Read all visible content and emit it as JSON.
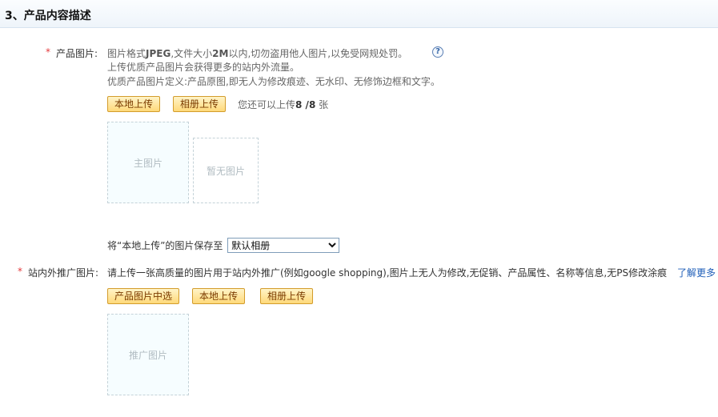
{
  "section": {
    "title": "3、产品内容描述"
  },
  "product_images": {
    "required_mark": "*",
    "label": "产品图片:",
    "hints": [
      [
        "图片格式",
        "JPEG",
        ",文件大小",
        "2M",
        "以内,切勿盗用他人图片,以免受网规处罚。"
      ],
      "上传优质产品图片会获得更多的站内外流量。",
      "优质产品图片定义:产品原图,即无人为修改痕迹、无水印、无修饰边框和文字。"
    ],
    "help_icon": "?",
    "buttons": {
      "local_upload": "本地上传",
      "album_upload": "相册上传"
    },
    "remaining": {
      "prefix": "您还可以上传",
      "count": "8",
      "separator": " /",
      "total": "8",
      "suffix": " 张"
    },
    "slots": {
      "main": "主图片",
      "empty": "暂无图片"
    },
    "save_to": {
      "label": "将“本地上传”的图片保存至",
      "selected": "默认相册"
    }
  },
  "promo_images": {
    "required_mark": "*",
    "label": "站内外推广图片:",
    "hint": "请上传一张高质量的图片用于站内外推广(例如google shopping),图片上无人为修改,无促销、产品属性、名称等信息,无PS修改涂痕",
    "learn_more": "了解更多",
    "buttons": {
      "pick_from_product": "产品图片中选",
      "local_upload": "本地上传",
      "album_upload": "相册上传"
    },
    "slot": "推广图片"
  }
}
